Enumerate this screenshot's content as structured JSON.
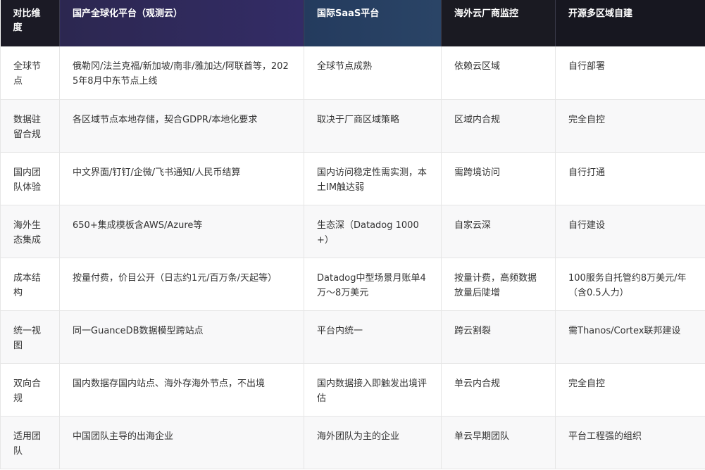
{
  "table": {
    "headers": [
      "对比维度",
      "国产全球化平台（观测云）",
      "国际SaaS平台",
      "海外云厂商监控",
      "开源多区域自建"
    ],
    "rows": [
      [
        "全球节点",
        "俄勒冈/法兰克福/新加坡/南非/雅加达/阿联酋等，2025年8月中东节点上线",
        "全球节点成熟",
        "依赖云区域",
        "自行部署"
      ],
      [
        "数据驻留合规",
        "各区域节点本地存储，契合GDPR/本地化要求",
        "取决于厂商区域策略",
        "区域内合规",
        "完全自控"
      ],
      [
        "国内团队体验",
        "中文界面/钉钉/企微/飞书通知/人民币结算",
        "国内访问稳定性需实测，本土IM触达弱",
        "需跨境访问",
        "自行打通"
      ],
      [
        "海外生态集成",
        "650+集成模板含AWS/Azure等",
        "生态深（Datadog 1000+）",
        "自家云深",
        "自行建设"
      ],
      [
        "成本结构",
        "按量付费，价目公开（日志约1元/百万条/天起等）",
        "Datadog中型场景月账单4万～8万美元",
        "按量计费，高频数据放量后陡增",
        "100服务自托管约8万美元/年（含0.5人力）"
      ],
      [
        "统一视图",
        "同一GuanceDB数据模型跨站点",
        "平台内统一",
        "跨云割裂",
        "需Thanos/Cortex联邦建设"
      ],
      [
        "双向合规",
        "国内数据存国内站点、海外存海外节点，不出境",
        "国内数据接入即触发出境评估",
        "单云内合规",
        "完全自控"
      ],
      [
        "适用团队",
        "中国团队主导的出海企业",
        "海外团队为主的企业",
        "单云早期团队",
        "平台工程强的组织"
      ]
    ]
  }
}
